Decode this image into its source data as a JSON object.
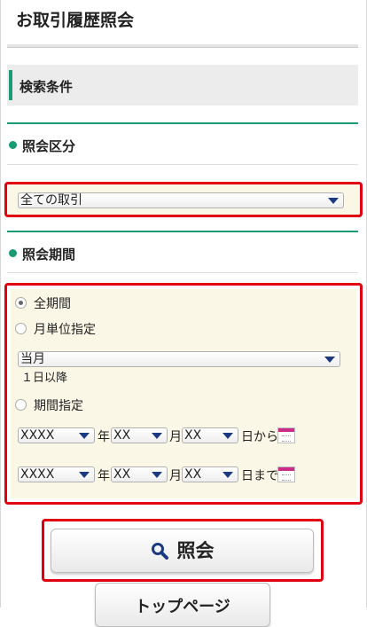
{
  "page": {
    "title": "お取引履歴照会"
  },
  "search": {
    "header": "検索条件"
  },
  "inquiry_type": {
    "title": "照会区分",
    "selected": "全ての取引"
  },
  "period": {
    "title": "照会期間",
    "options": {
      "all": "全期間",
      "monthly": "月単位指定",
      "range": "期間指定"
    },
    "selected_option": "all",
    "month_select": "当月",
    "month_note": "１日以降",
    "from": {
      "year": "XXXX",
      "month": "XX",
      "day": "XX",
      "year_unit": "年",
      "month_unit": "月",
      "suffix": "日から"
    },
    "to": {
      "year": "XXXX",
      "month": "XX",
      "day": "XX",
      "year_unit": "年",
      "month_unit": "月",
      "suffix": "日まで"
    }
  },
  "actions": {
    "inquiry": "照会",
    "top_page": "トップページ"
  },
  "colors": {
    "accent": "#1a9a75",
    "highlight_border": "#e00012",
    "panel": "#fbf7e6",
    "calendar": "#cc2b8a"
  }
}
